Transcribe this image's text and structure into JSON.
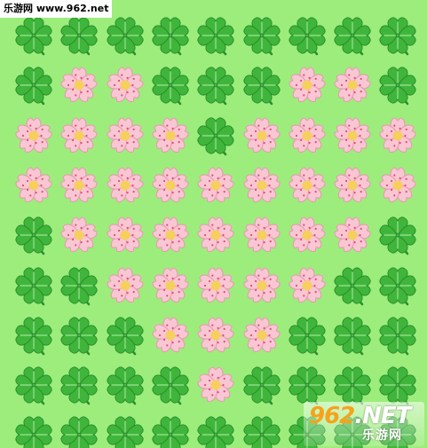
{
  "page": {
    "background_color": "#9ded7c",
    "site_banner": "乐游网 www.962.net"
  },
  "watermark": {
    "brand_number": "962",
    "brand_suffix": ".NET",
    "brand_subtitle": "乐游网"
  },
  "colors": {
    "clover_leaf": "#3fb63b",
    "clover_leaf_dark": "#2a8f2c",
    "clover_vein": "#8fdc86",
    "blossom_petal": "#f9c7d4",
    "blossom_petal_edge": "#e79bb0",
    "blossom_center": "#f6cf5c",
    "blossom_dot": "#e6497a",
    "logo_orange": "#f7a21b"
  },
  "icons": {
    "clover": "four-leaf-clover-icon",
    "blossom": "cherry-blossom-icon"
  },
  "grid": {
    "rows": 9,
    "cols": 9,
    "legend": "C = four-leaf clover, B = cherry blossom",
    "pattern": [
      "CCCCCCCCC",
      "CBBCCCBBC",
      "BBBBCBBBB",
      "BBBBBBBBB",
      "CBBBBBBBC",
      "CCBBBBBCC",
      "CCCBBBCCC",
      "CCCCBCCCC",
      "CCCCCCCCC"
    ]
  }
}
